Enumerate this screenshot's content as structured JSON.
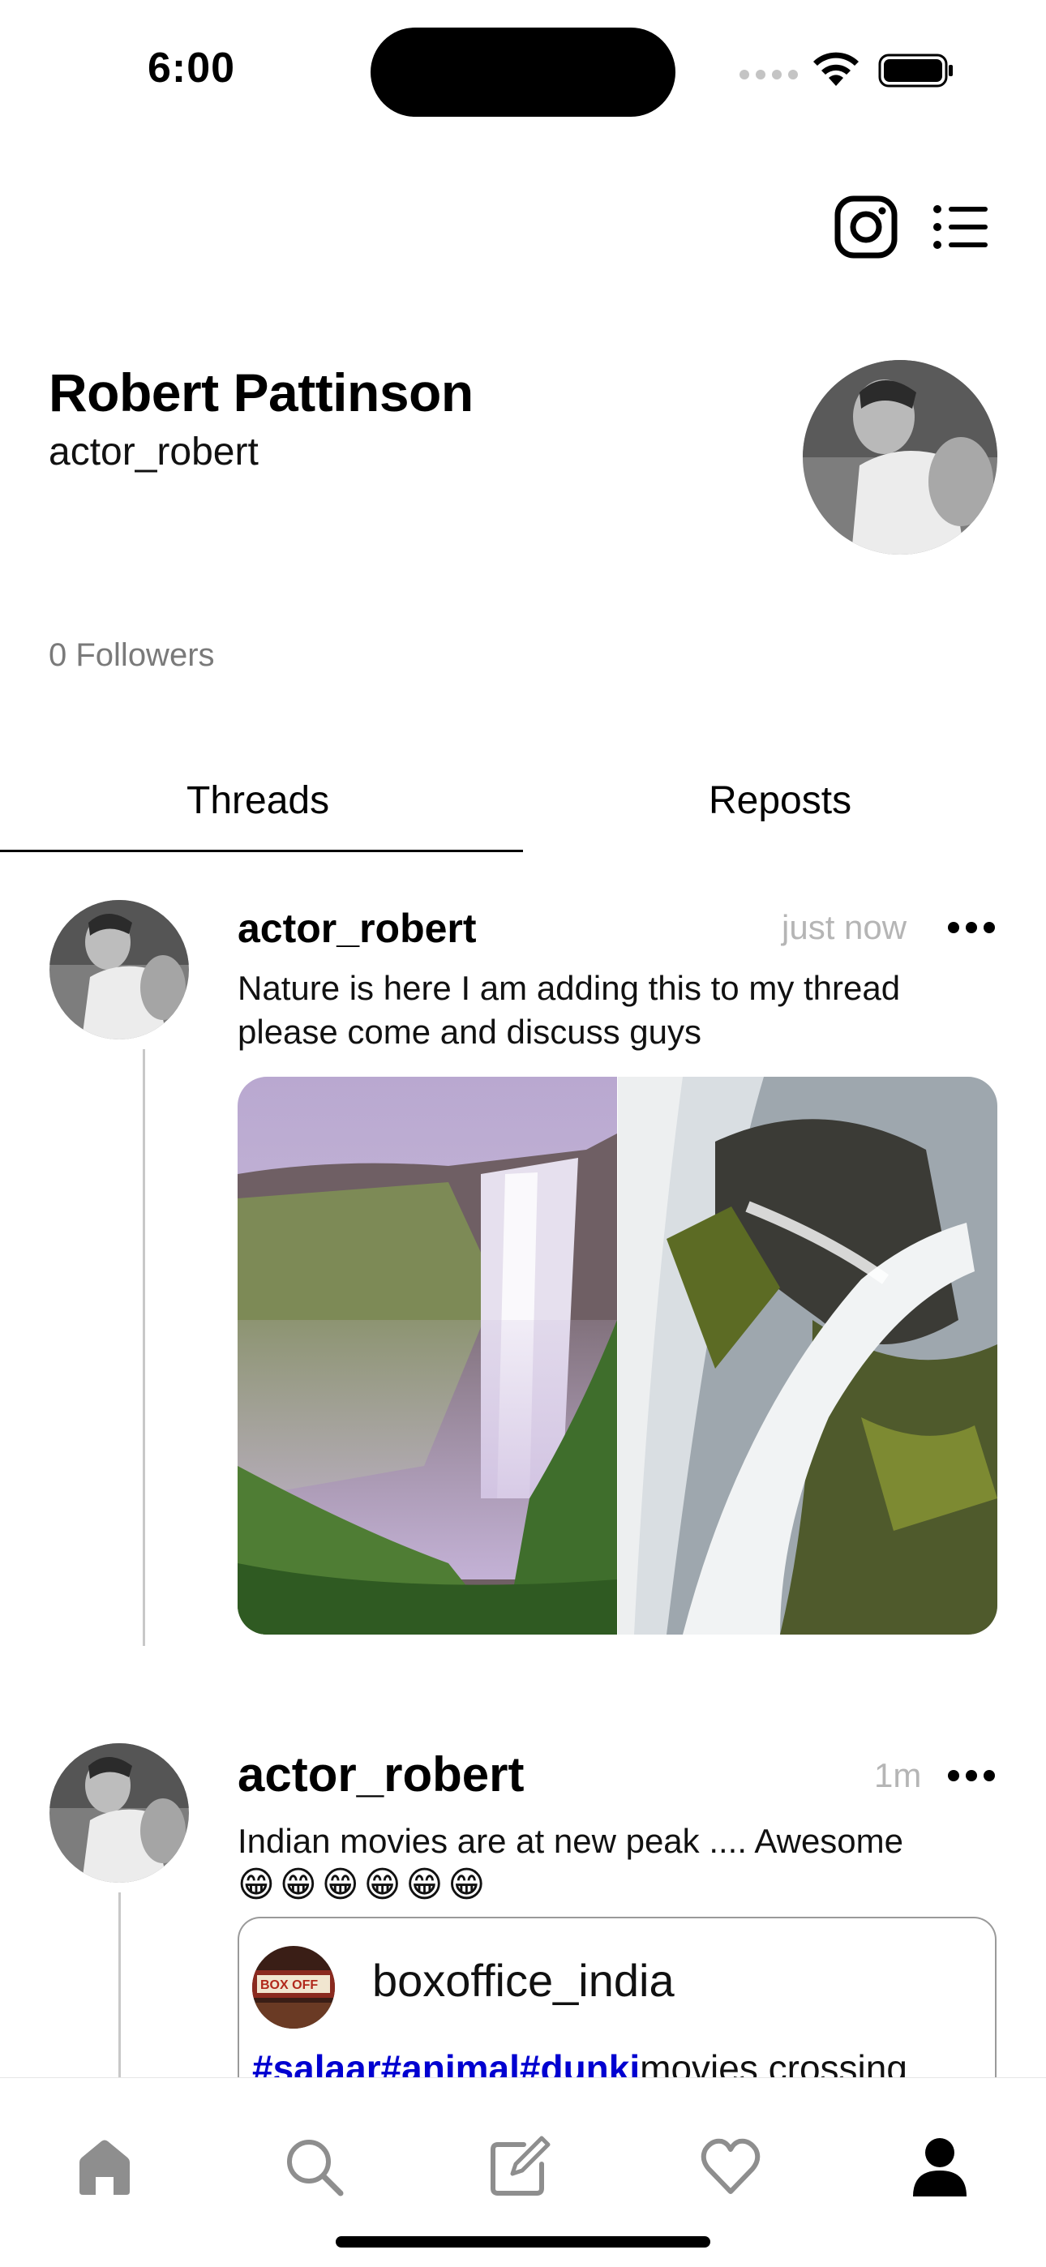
{
  "status_bar": {
    "time": "6:00"
  },
  "header": {
    "instagram_icon": "instagram-icon",
    "menu_icon": "menu-icon"
  },
  "profile": {
    "name": "Robert Pattinson",
    "handle": "actor_robert",
    "followers": "0 Followers"
  },
  "tabs": [
    {
      "label": "Threads",
      "active": true
    },
    {
      "label": "Reposts",
      "active": false
    }
  ],
  "posts": [
    {
      "user": "actor_robert",
      "time": "just now",
      "text": "Nature is here I am adding this to my thread please come and discuss guys",
      "images": [
        "waterfall-cliff-photo",
        "waterfall-rocks-photo"
      ]
    },
    {
      "user": "actor_robert",
      "time": "1m",
      "text": "Indian movies are at new peak .... Awesome",
      "emojis": "😁😁😁😁😁😁",
      "quote": {
        "user": "boxoffice_india",
        "hashtags": "#salaar#animal#dunki",
        "text": "movies crossing"
      }
    }
  ],
  "tabbar": {
    "items": [
      "home-icon",
      "search-icon",
      "compose-icon",
      "heart-icon",
      "profile-icon"
    ],
    "active": "profile-icon"
  },
  "colors": {
    "hashtag": "#0000d0",
    "muted": "#7a7a7a",
    "time": "#b5b5b5"
  }
}
